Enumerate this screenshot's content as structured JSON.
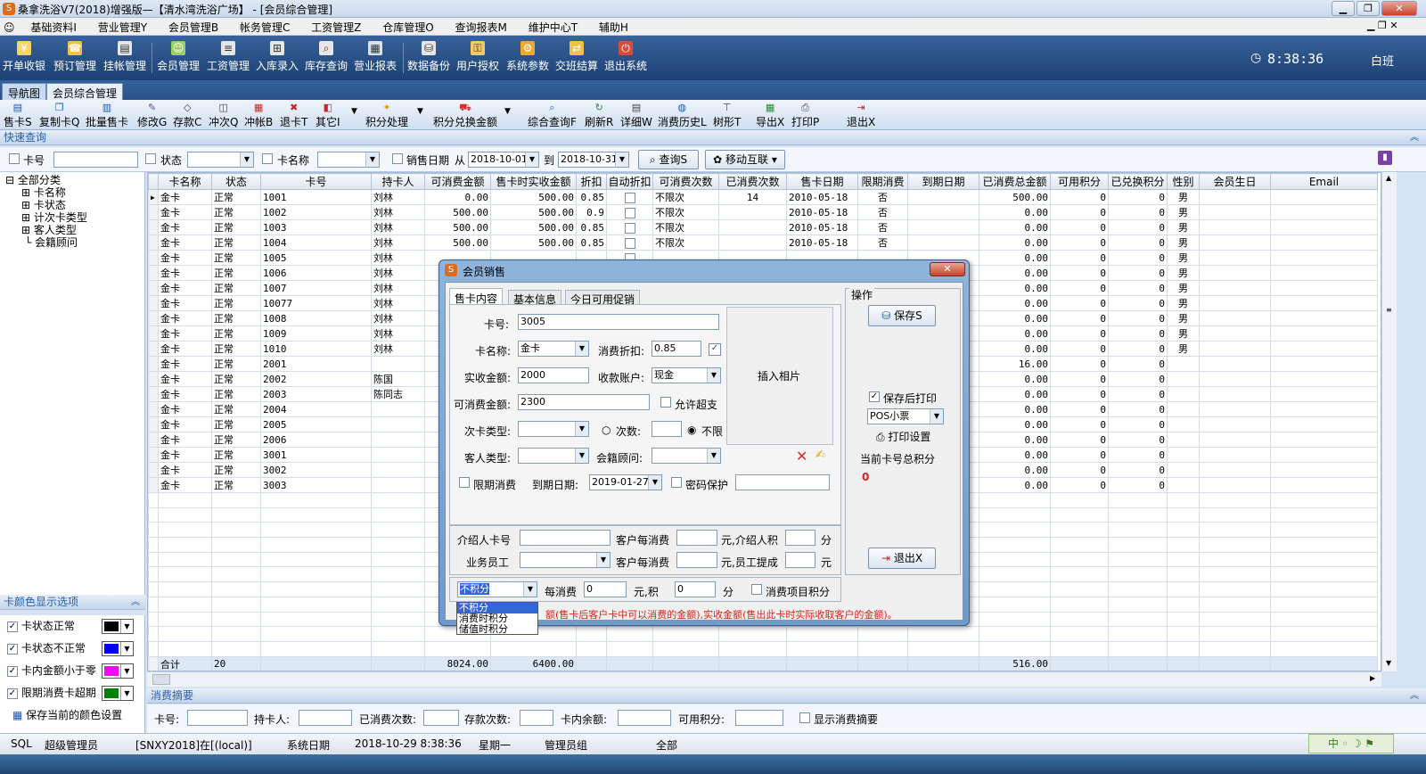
{
  "window": {
    "title": "桑拿洗浴V7(2018)增强版—【清水湾洗浴广场】 - [会员综合管理]"
  },
  "menu": [
    "基础资料I",
    "营业管理Y",
    "会员管理B",
    "帐务管理C",
    "工资管理Z",
    "仓库管理O",
    "查询报表M",
    "维护中心T",
    "辅助H"
  ],
  "bigtoolbar": {
    "items": [
      "开单收银",
      "预订管理",
      "挂帐管理",
      "会员管理",
      "工资管理",
      "入库录入",
      "库存查询",
      "营业报表",
      "数据备份",
      "用户授权",
      "系统参数",
      "交班结算",
      "退出系统"
    ],
    "clock": "8:38:36",
    "shift": "白班"
  },
  "tabs": [
    "导航图",
    "会员综合管理"
  ],
  "toolbar2": [
    "售卡S",
    "复制卡Q",
    "批量售卡",
    "修改G",
    "存款C",
    "冲次Q",
    "冲帐B",
    "退卡T",
    "其它I",
    "积分处理",
    "积分兑换金额",
    "综合查询F",
    "刷新R",
    "详细W",
    "消费历史L",
    "树形T",
    "导出X",
    "打印P",
    "退出X"
  ],
  "quick": {
    "title": "快速查询",
    "card_no": "卡号",
    "state": "状态",
    "card_name": "卡名称",
    "sale_date": "销售日期",
    "from": "从",
    "from_date": "2018-10-01",
    "to": "到",
    "to_date": "2018-10-31",
    "query": "查询S",
    "mobile": "移动互联"
  },
  "tree": {
    "root": "全部分类",
    "items": [
      "卡名称",
      "卡状态",
      "计次卡类型",
      "客人类型",
      "会籍顾问"
    ]
  },
  "grid": {
    "headers": [
      "卡名称",
      "状态",
      "卡号",
      "持卡人",
      "可消费金额",
      "售卡时实收金额",
      "折扣",
      "自动折扣",
      "可消费次数",
      "已消费次数",
      "售卡日期",
      "限期消费",
      "到期日期",
      "已消费总金额",
      "可用积分",
      "已兑换积分",
      "性别",
      "会员生日",
      "Email"
    ],
    "rows": [
      [
        "金卡",
        "正常",
        "1001",
        "刘林",
        "0.00",
        "500.00",
        "0.85",
        "",
        "不限次",
        "14",
        "2010-05-18",
        "否",
        "",
        "500.00",
        "0",
        "0",
        "男"
      ],
      [
        "金卡",
        "正常",
        "1002",
        "刘林",
        "500.00",
        "500.00",
        "0.9",
        "",
        "不限次",
        "",
        "2010-05-18",
        "否",
        "",
        "0.00",
        "0",
        "0",
        "男"
      ],
      [
        "金卡",
        "正常",
        "1003",
        "刘林",
        "500.00",
        "500.00",
        "0.85",
        "",
        "不限次",
        "",
        "2010-05-18",
        "否",
        "",
        "0.00",
        "0",
        "0",
        "男"
      ],
      [
        "金卡",
        "正常",
        "1004",
        "刘林",
        "500.00",
        "500.00",
        "0.85",
        "",
        "不限次",
        "",
        "2010-05-18",
        "否",
        "",
        "0.00",
        "0",
        "0",
        "男"
      ],
      [
        "金卡",
        "正常",
        "1005",
        "刘林",
        "",
        "",
        "",
        "",
        "",
        "",
        "",
        "",
        "",
        "0.00",
        "0",
        "0",
        "男"
      ],
      [
        "金卡",
        "正常",
        "1006",
        "刘林",
        "",
        "",
        "",
        "",
        "",
        "",
        "",
        "",
        "",
        "0.00",
        "0",
        "0",
        "男"
      ],
      [
        "金卡",
        "正常",
        "1007",
        "刘林",
        "",
        "",
        "",
        "",
        "",
        "",
        "",
        "",
        "",
        "0.00",
        "0",
        "0",
        "男"
      ],
      [
        "金卡",
        "正常",
        "10077",
        "刘林",
        "",
        "",
        "",
        "",
        "",
        "",
        "",
        "",
        "",
        "0.00",
        "0",
        "0",
        "男"
      ],
      [
        "金卡",
        "正常",
        "1008",
        "刘林",
        "",
        "",
        "",
        "",
        "",
        "",
        "",
        "",
        "",
        "0.00",
        "0",
        "0",
        "男"
      ],
      [
        "金卡",
        "正常",
        "1009",
        "刘林",
        "",
        "",
        "",
        "",
        "",
        "",
        "",
        "",
        "",
        "0.00",
        "0",
        "0",
        "男"
      ],
      [
        "金卡",
        "正常",
        "1010",
        "刘林",
        "",
        "",
        "",
        "",
        "",
        "",
        "",
        "",
        "",
        "0.00",
        "0",
        "0",
        "男"
      ],
      [
        "金卡",
        "正常",
        "2001",
        "",
        "",
        "",
        "",
        "",
        "",
        "",
        "",
        "",
        "",
        "16.00",
        "0",
        "0",
        ""
      ],
      [
        "金卡",
        "正常",
        "2002",
        "陈国",
        "",
        "",
        "",
        "",
        "",
        "",
        "",
        "",
        "",
        "0.00",
        "0",
        "0",
        ""
      ],
      [
        "金卡",
        "正常",
        "2003",
        "陈同志",
        "",
        "",
        "",
        "",
        "",
        "",
        "",
        "",
        "",
        "0.00",
        "0",
        "0",
        ""
      ],
      [
        "金卡",
        "正常",
        "2004",
        "",
        "",
        "",
        "",
        "",
        "",
        "",
        "",
        "",
        "",
        "0.00",
        "0",
        "0",
        ""
      ],
      [
        "金卡",
        "正常",
        "2005",
        "",
        "",
        "",
        "",
        "",
        "",
        "",
        "",
        "",
        "",
        "0.00",
        "0",
        "0",
        ""
      ],
      [
        "金卡",
        "正常",
        "2006",
        "",
        "",
        "",
        "",
        "",
        "",
        "",
        "",
        "",
        "",
        "0.00",
        "0",
        "0",
        ""
      ],
      [
        "金卡",
        "正常",
        "3001",
        "",
        "",
        "",
        "",
        "",
        "",
        "",
        "",
        "",
        "",
        "0.00",
        "0",
        "0",
        ""
      ],
      [
        "金卡",
        "正常",
        "3002",
        "",
        "",
        "",
        "",
        "",
        "",
        "",
        "",
        "",
        "",
        "0.00",
        "0",
        "0",
        ""
      ],
      [
        "金卡",
        "正常",
        "3003",
        "",
        "",
        "",
        "",
        "",
        "",
        "",
        "",
        "",
        "",
        "0.00",
        "0",
        "0",
        ""
      ]
    ],
    "total": {
      "label": "合计",
      "count": "20",
      "amount": "8024.00",
      "paid": "6400.00",
      "consumed": "516.00"
    }
  },
  "colorpanel": {
    "title": "卡颜色显示选项",
    "items": [
      {
        "label": "卡状态正常",
        "color": "#000000"
      },
      {
        "label": "卡状态不正常",
        "color": "#0000ff"
      },
      {
        "label": "卡内金额小于零",
        "color": "#ff00ff"
      },
      {
        "label": "限期消费卡超期",
        "color": "#008000"
      }
    ],
    "save": "保存当前的颜色设置"
  },
  "summary": {
    "title": "消费摘要",
    "labels": [
      "卡号:",
      "持卡人:",
      "已消费次数:",
      "存款次数:",
      "卡内余额:",
      "可用积分:"
    ],
    "show": "显示消费摘要"
  },
  "status": {
    "db": "SQL",
    "user": "超级管理员",
    "server": "[SNXY2018]在[(local)]",
    "sysdate_label": "系统日期",
    "sysdate": "2018-10-29   8:38:36",
    "weekday": "星期一",
    "group": "管理员组",
    "scope": "全部"
  },
  "dialog": {
    "title": "会员销售",
    "tabs": [
      "售卡内容",
      "基本信息",
      "今日可用促销"
    ],
    "card_no_label": "卡号:",
    "card_no": "3005",
    "card_name_label": "卡名称:",
    "card_name": "金卡",
    "discount_label": "消费折扣:",
    "discount": "0.85",
    "paid_label": "实收金额:",
    "paid": "2000",
    "account_label": "收款账户:",
    "account": "现金",
    "avail_label": "可消费金额:",
    "avail": "2300",
    "overdraw": "允许超支",
    "times_type_label": "次卡类型:",
    "times_label": "次数:",
    "unlimited": "不限",
    "guest_type_label": "客人类型:",
    "advisor_label": "会籍顾问:",
    "limit_label": "限期消费",
    "expire_label": "到期日期:",
    "expire": "2019-01-27",
    "pwd_label": "密码保护",
    "photo": "插入相片",
    "referrer_label": "介绍人卡号",
    "per_spend1": "客户每消费",
    "unit1": "元,介绍人积",
    "fen": "分",
    "staff_label": "业务员工",
    "per_spend2": "客户每消费",
    "unit2": "元,员工提成",
    "yuan": "元",
    "points_mode": "不积分",
    "per_consume": "每消费",
    "points_val1": "0",
    "yuan_ji": "元,积",
    "points_val2": "0",
    "fen2": "分",
    "item_points": "消费项目积分",
    "points_options": [
      "不积分",
      "消费时积分",
      "储值时积分"
    ],
    "note": "额(售卡后客户卡中可以消费的金额),实收金额(售出此卡时实际收取客户的金额)。",
    "ops_title": "操作",
    "save": "保存S",
    "print_after": "保存后打印",
    "printer": "POS小票",
    "print_setup": "打印设置",
    "total_points_label": "当前卡号总积分",
    "total_points": "0",
    "exit": "退出X"
  }
}
